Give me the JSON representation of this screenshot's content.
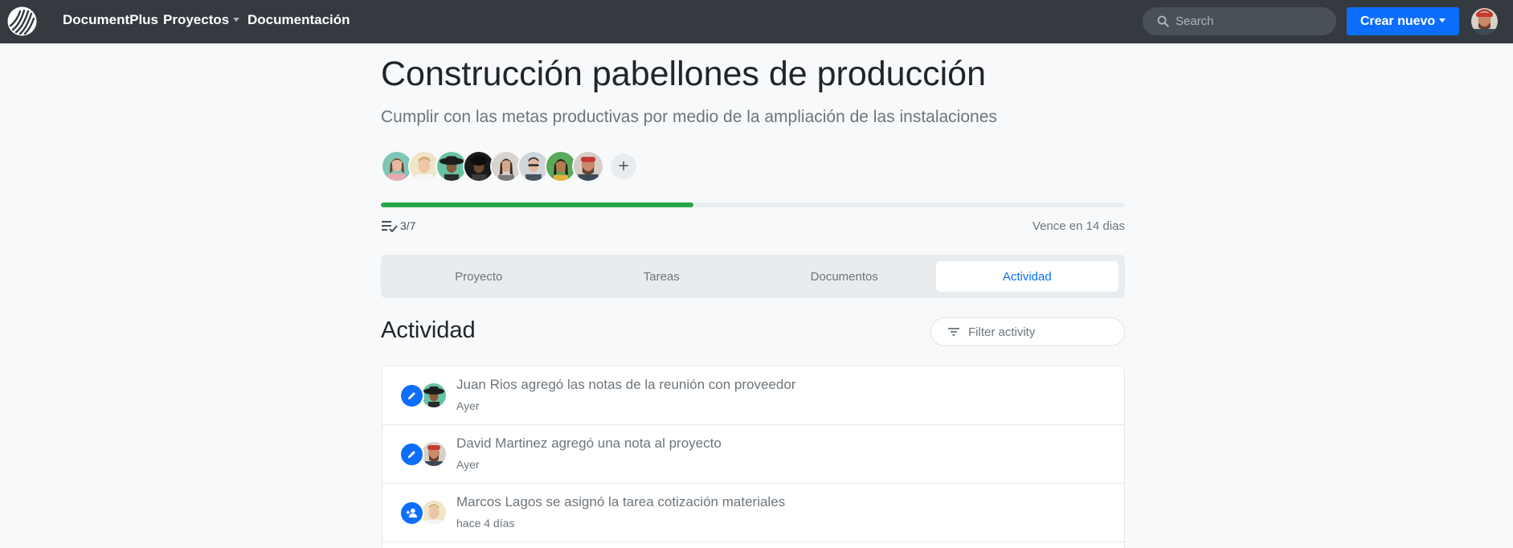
{
  "topbar": {
    "brand": "DocumentPlus",
    "nav": [
      {
        "label": "Proyectos",
        "has_dropdown": true
      },
      {
        "label": "Documentación",
        "has_dropdown": false
      }
    ],
    "search_placeholder": "Search",
    "create_label": "Crear nuevo",
    "icons": [
      "logo-icon",
      "search-icon",
      "user-avatar"
    ]
  },
  "project": {
    "title": "Construcción pabellones de producción",
    "subtitle": "Cumplir con las metas productivas por medio de la ampliación de las instalaciones",
    "add_member_label": "+",
    "progress_fraction": 0.42,
    "tasks_done": "3/7",
    "due": "Vence en 14 dias"
  },
  "tabs": [
    {
      "label": "Proyecto",
      "active": false
    },
    {
      "label": "Tareas",
      "active": false
    },
    {
      "label": "Documentos",
      "active": false
    },
    {
      "label": "Actividad",
      "active": true
    }
  ],
  "activity": {
    "title": "Actividad",
    "filter_placeholder": "Filter activity",
    "items": [
      {
        "text": "Juan Rios agregó las notas de la reunión con proveedor",
        "time": "Ayer",
        "icon": "pencil-icon"
      },
      {
        "text": "David Martinez agregó una nota al proyecto",
        "time": "Ayer",
        "icon": "pencil-icon"
      },
      {
        "text": "Marcos Lagos se asignó la tarea cotización materiales",
        "time": "hace 4 días",
        "icon": "user-add-icon"
      }
    ]
  },
  "colors": {
    "topbar": "#343a40",
    "primary": "#0d6efd",
    "progress": "#28a745",
    "page_bg": "#f8f9fa"
  }
}
